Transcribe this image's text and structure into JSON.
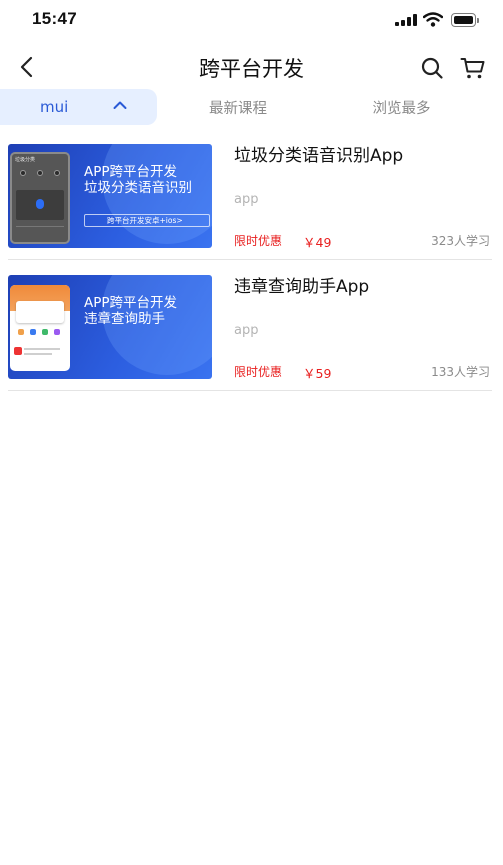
{
  "status_bar": {
    "time": "15:47"
  },
  "header": {
    "title": "跨平台开发",
    "back_icon": "chevron-left-icon",
    "search_icon": "search-icon",
    "cart_icon": "cart-icon"
  },
  "tabs": [
    {
      "label": "mui",
      "active": true,
      "icon": "chevron-up-icon"
    },
    {
      "label": "最新课程",
      "active": false
    },
    {
      "label": "浏览最多",
      "active": false
    }
  ],
  "colors": {
    "accent": "#2a5ad6",
    "tab_active_bg": "#e6efff",
    "price": "#e82020",
    "muted": "#8a8a8a",
    "thumb_blue": "#2c5ee0"
  },
  "courses": [
    {
      "title": "垃圾分类语音识别App",
      "tag": "app",
      "promo_label": "限时优惠",
      "price": "￥49",
      "learners": "323人学习",
      "thumb": {
        "headline_1": "APP跨平台开发",
        "headline_2": "垃圾分类语音识别",
        "strip": "跨平台开发安卓+ios>"
      }
    },
    {
      "title": "违章查询助手App",
      "tag": "app",
      "promo_label": "限时优惠",
      "price": "￥59",
      "learners": "133人学习",
      "thumb": {
        "headline_1": "APP跨平台开发",
        "headline_2": "违章查询助手"
      }
    }
  ]
}
